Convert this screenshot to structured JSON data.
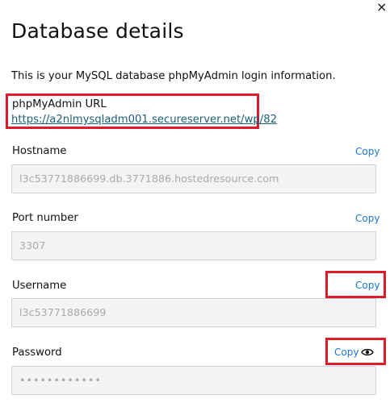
{
  "dialog": {
    "close_glyph": "×",
    "title": "Database details",
    "intro": "This is your MySQL database phpMyAdmin login information."
  },
  "phpmyadmin": {
    "label": "phpMyAdmin URL",
    "url": "https://a2nlmysqladm001.secureserver.net/wp/82"
  },
  "fields": {
    "hostname": {
      "label": "Hostname",
      "value": "l3c53771886699.db.3771886.hostedresource.com",
      "copy": "Copy"
    },
    "port": {
      "label": "Port number",
      "value": "3307",
      "copy": "Copy"
    },
    "username": {
      "label": "Username",
      "value": "l3c53771886699",
      "copy": "Copy"
    },
    "password": {
      "label": "Password",
      "value": "••••••••••••",
      "copy": "Copy",
      "reveal_icon": "eye-icon"
    }
  },
  "colors": {
    "highlight": "#e01a2b",
    "link": "#1c5d75",
    "copy": "#1976d2"
  }
}
